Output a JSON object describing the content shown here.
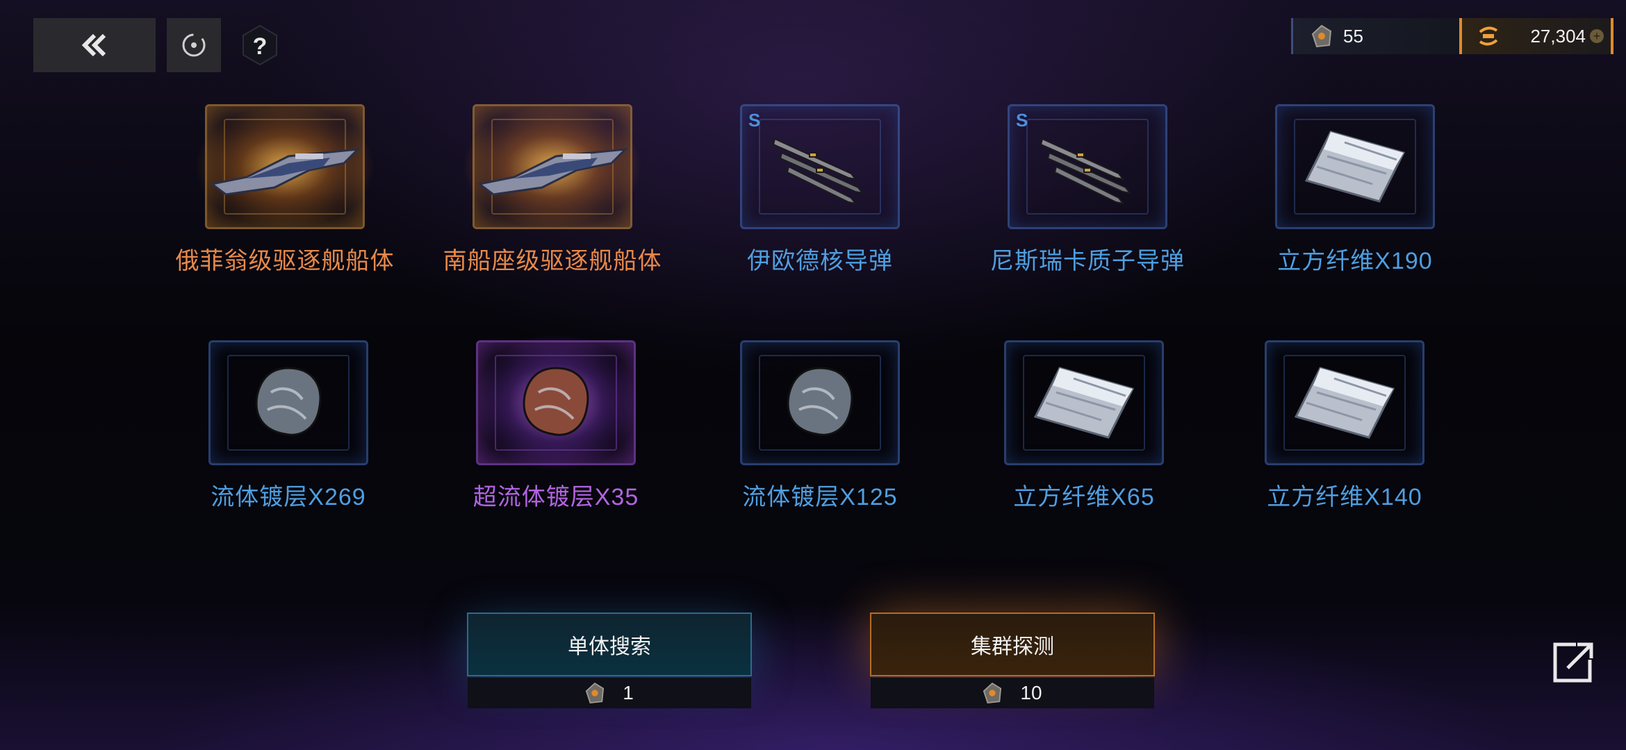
{
  "header": {
    "back_icon": "double-chevron-left-icon",
    "refresh_icon": "refresh-target-icon",
    "help_icon": "question-hex-icon",
    "currencies": [
      {
        "icon": "probe-token-icon",
        "value": "55"
      },
      {
        "icon": "gold-credit-icon",
        "value": "27,304",
        "add": "+"
      }
    ]
  },
  "rewards": [
    {
      "name": "俄菲翁级驱逐舰船体",
      "qty": "",
      "rarity": "gold",
      "art": "destroyer-hull-icon"
    },
    {
      "name": "南船座级驱逐舰船体",
      "qty": "",
      "rarity": "gold",
      "art": "destroyer-hull-icon"
    },
    {
      "name": "伊欧德核导弹",
      "qty": "",
      "rarity": "blue",
      "badge": "S",
      "art": "missile-icon"
    },
    {
      "name": "尼斯瑞卡质子导弹",
      "qty": "",
      "rarity": "blue",
      "badge": "S",
      "art": "missile-icon"
    },
    {
      "name": "立方纤维",
      "qty": "X190",
      "rarity": "blue",
      "art": "fiber-sheet-icon"
    },
    {
      "name": "流体镀层",
      "qty": "X269",
      "rarity": "blue",
      "art": "fluid-coating-icon"
    },
    {
      "name": "超流体镀层",
      "qty": "X35",
      "rarity": "purple",
      "art": "fluid-coating-icon"
    },
    {
      "name": "流体镀层",
      "qty": "X125",
      "rarity": "blue",
      "art": "fluid-coating-icon"
    },
    {
      "name": "立方纤维",
      "qty": "X65",
      "rarity": "blue",
      "art": "fiber-sheet-icon"
    },
    {
      "name": "立方纤维",
      "qty": "X140",
      "rarity": "blue",
      "art": "fiber-sheet-icon"
    }
  ],
  "actions": {
    "single": {
      "label": "单体搜索",
      "cost": "1"
    },
    "cluster": {
      "label": "集群探测",
      "cost": "10"
    }
  },
  "share_icon": "external-link-icon",
  "colors": {
    "gold": "#e7894a",
    "blue": "#4f9ee0",
    "purple": "#b164e0",
    "accent_orange": "#e08a2c"
  }
}
